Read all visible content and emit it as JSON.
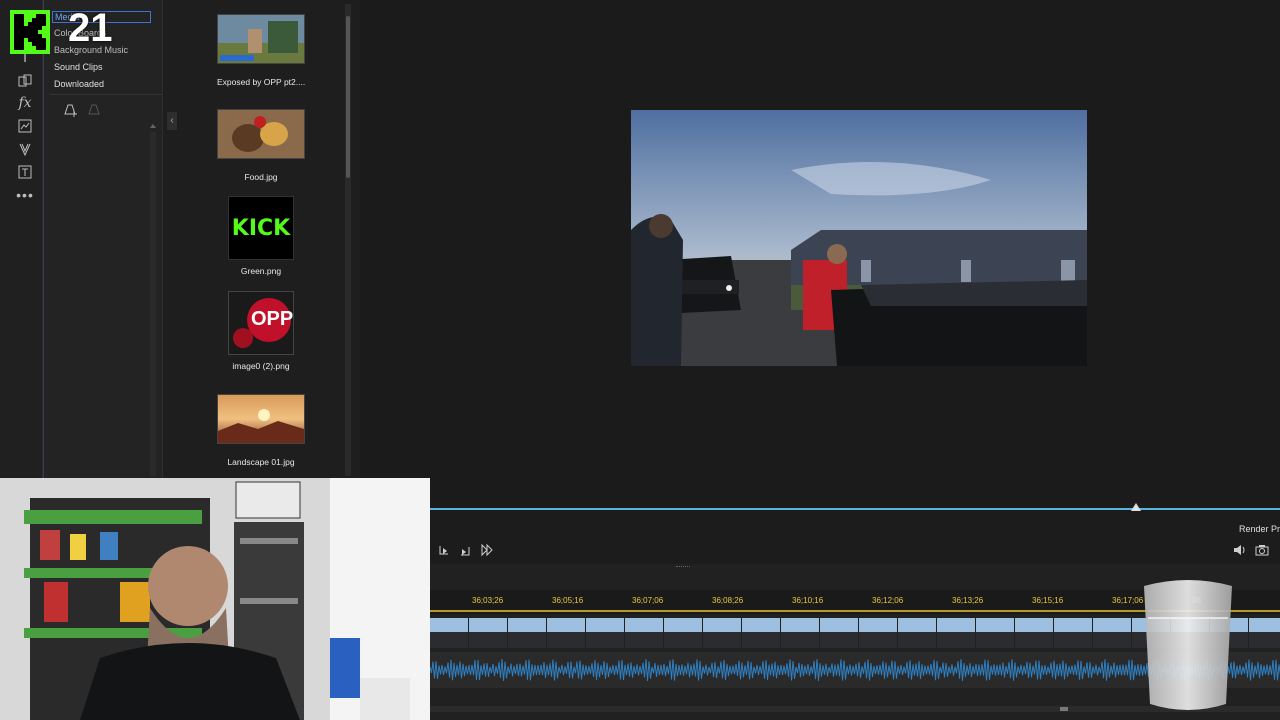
{
  "library": {
    "tree_items": [
      "Media",
      "Color Boards",
      "Background Music",
      "Sound Clips",
      "Downloaded"
    ]
  },
  "media": {
    "items": [
      {
        "label": "Exposed by OPP pt2...."
      },
      {
        "label": "Food.jpg"
      },
      {
        "label": "Green.png",
        "thumb_text": "KICK"
      },
      {
        "label": "image0 (2).png",
        "thumb_text": "OPP"
      },
      {
        "label": "Landscape 01.jpg"
      }
    ]
  },
  "logo": {
    "letter": "K",
    "number": "21"
  },
  "preview": {
    "progress": 0.83
  },
  "controls": {
    "render_label": "Render Pr"
  },
  "timeline": {
    "ticks": [
      "36;03;26",
      "36;05;16",
      "36;07;06",
      "36;08;26",
      "36;10;16",
      "36;12;06",
      "36;13;26",
      "36;15;16",
      "36;17;06",
      "36"
    ]
  },
  "colors": {
    "accent": "#5ab4e0",
    "kick_green": "#53fc18",
    "ruler_tick": "#e8c840"
  }
}
